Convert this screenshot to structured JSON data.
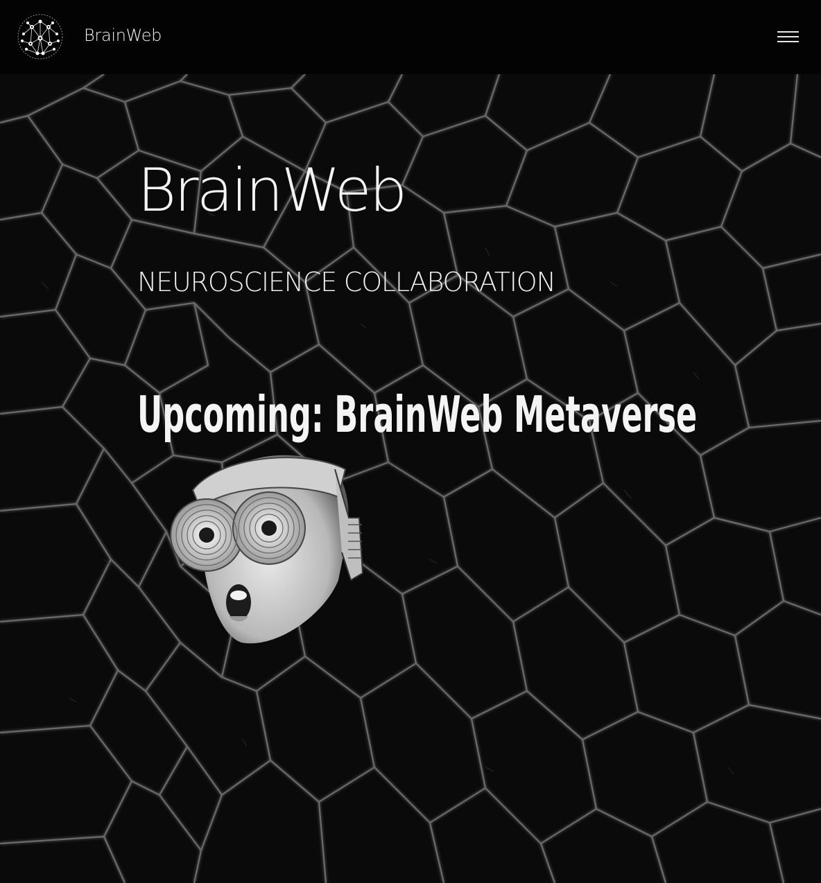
{
  "navbar": {
    "brand": "BrainWeb",
    "logo_icon": "neural-network-sphere-icon",
    "menu_icon": "hamburger-menu-icon"
  },
  "hero": {
    "title": "BrainWeb",
    "subtitle": "NEUROSCIENCE COLLABORATION",
    "announcement": "Upcoming: BrainWeb Metaverse",
    "image_icon": "vr-goggles-head-illustration"
  },
  "colors": {
    "navbar_bg": "#030303",
    "hero_bg": "#0a0a0a",
    "text": "#f3f3f3"
  }
}
